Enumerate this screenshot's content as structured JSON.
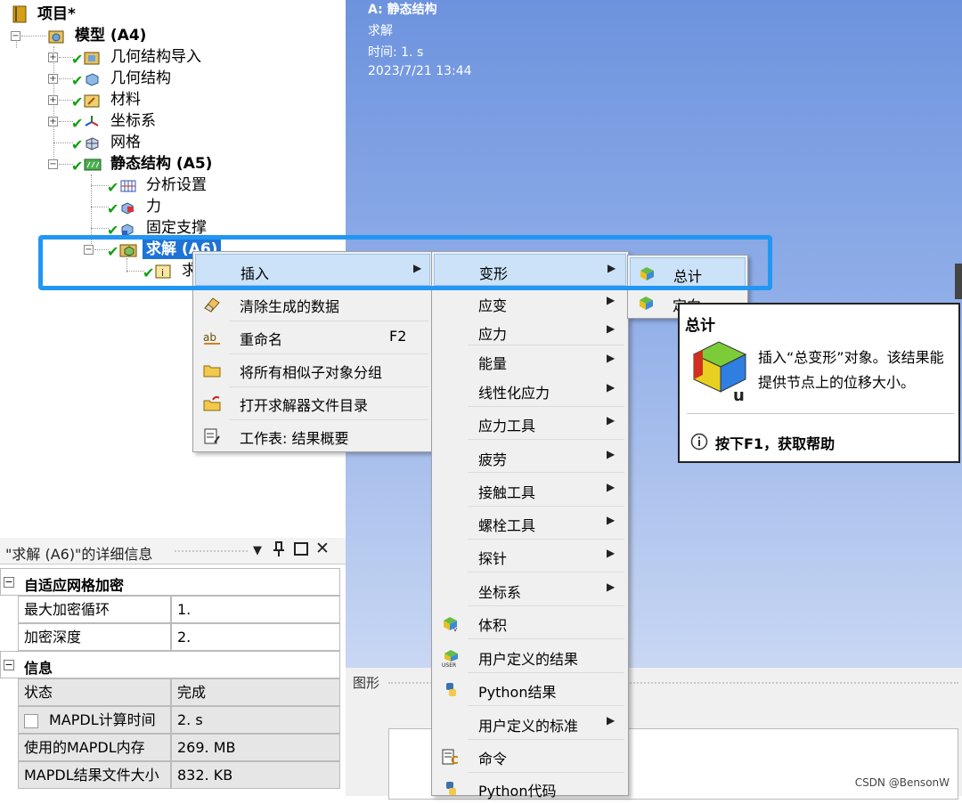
{
  "tree": {
    "project": "项目*",
    "model": "模型 (A4)",
    "geometry_import": "几何结构导入",
    "geometry": "几何结构",
    "materials": "材料",
    "coordinate_systems": "坐标系",
    "mesh": "网格",
    "static_structural": "静态结构 (A5)",
    "analysis_settings": "分析设置",
    "force": "力",
    "fixed_support": "固定支撑",
    "solution": "求解 (A6)",
    "solution_info": "求"
  },
  "viewport": {
    "title": "A: 静态结构",
    "subtitle": "求解",
    "time": "时间: 1. s",
    "date": "2023/7/21 13:44"
  },
  "context_menu": {
    "items": [
      {
        "label": "插入",
        "icon": "none",
        "arrow": "▶"
      },
      {
        "label": "清除生成的数据",
        "icon": "eraser-icon"
      },
      {
        "label": "重命名",
        "icon": "rename-icon",
        "shortcut": "F2"
      },
      {
        "label": "将所有相似子对象分组",
        "icon": "folder-icon"
      },
      {
        "label": "打开求解器文件目录",
        "icon": "folder-open-icon"
      },
      {
        "label": "工作表: 结果概要",
        "icon": "worksheet-icon"
      }
    ]
  },
  "insert_submenu": {
    "items": [
      {
        "label": "变形",
        "arrow": "▶"
      },
      {
        "label": "应变",
        "arrow": "▶"
      },
      {
        "label": "应力",
        "arrow": "▶"
      },
      {
        "label": "能量",
        "arrow": "▶"
      },
      {
        "label": "线性化应力",
        "arrow": "▶"
      },
      {
        "label": "应力工具",
        "arrow": "▶"
      },
      {
        "label": "疲劳",
        "arrow": "▶"
      },
      {
        "label": "接触工具",
        "arrow": "▶"
      },
      {
        "label": "螺栓工具",
        "arrow": "▶"
      },
      {
        "label": "探针",
        "arrow": "▶"
      },
      {
        "label": "坐标系",
        "arrow": "▶"
      },
      {
        "label": "体积"
      },
      {
        "label": "用户定义的结果"
      },
      {
        "label": "Python结果"
      },
      {
        "label": "用户定义的标准",
        "arrow": "▶"
      },
      {
        "label": "命令"
      },
      {
        "label": "Python代码"
      }
    ]
  },
  "deformation_submenu": {
    "items": [
      {
        "label": "总计"
      },
      {
        "label": "定向"
      }
    ]
  },
  "tooltip": {
    "title": "总计",
    "body": "插入“总变形”对象。该结果能提供节点上的位移大小。",
    "help": "按下F1，获取帮助"
  },
  "details": {
    "title": "\"求解 (A6)\"的详细信息",
    "sections": [
      {
        "name": "自适应网格加密",
        "rows": [
          {
            "key": "最大加密循环",
            "value": "1."
          },
          {
            "key": "加密深度",
            "value": "2."
          }
        ]
      },
      {
        "name": "信息",
        "rows": [
          {
            "key": "状态",
            "value": "完成"
          },
          {
            "key": "MAPDL计算时间",
            "value": "2. s"
          },
          {
            "key": "使用的MAPDL内存",
            "value": "269. MB"
          },
          {
            "key": "MAPDL结果文件大小",
            "value": "832. KB"
          }
        ]
      }
    ]
  },
  "graph_panel": {
    "title": "图形"
  },
  "watermark": "CSDN @BensonW",
  "colors": {
    "accent_highlight": "#2196f3",
    "check_green": "#12a012",
    "menu_hover": "#cce2f8"
  }
}
